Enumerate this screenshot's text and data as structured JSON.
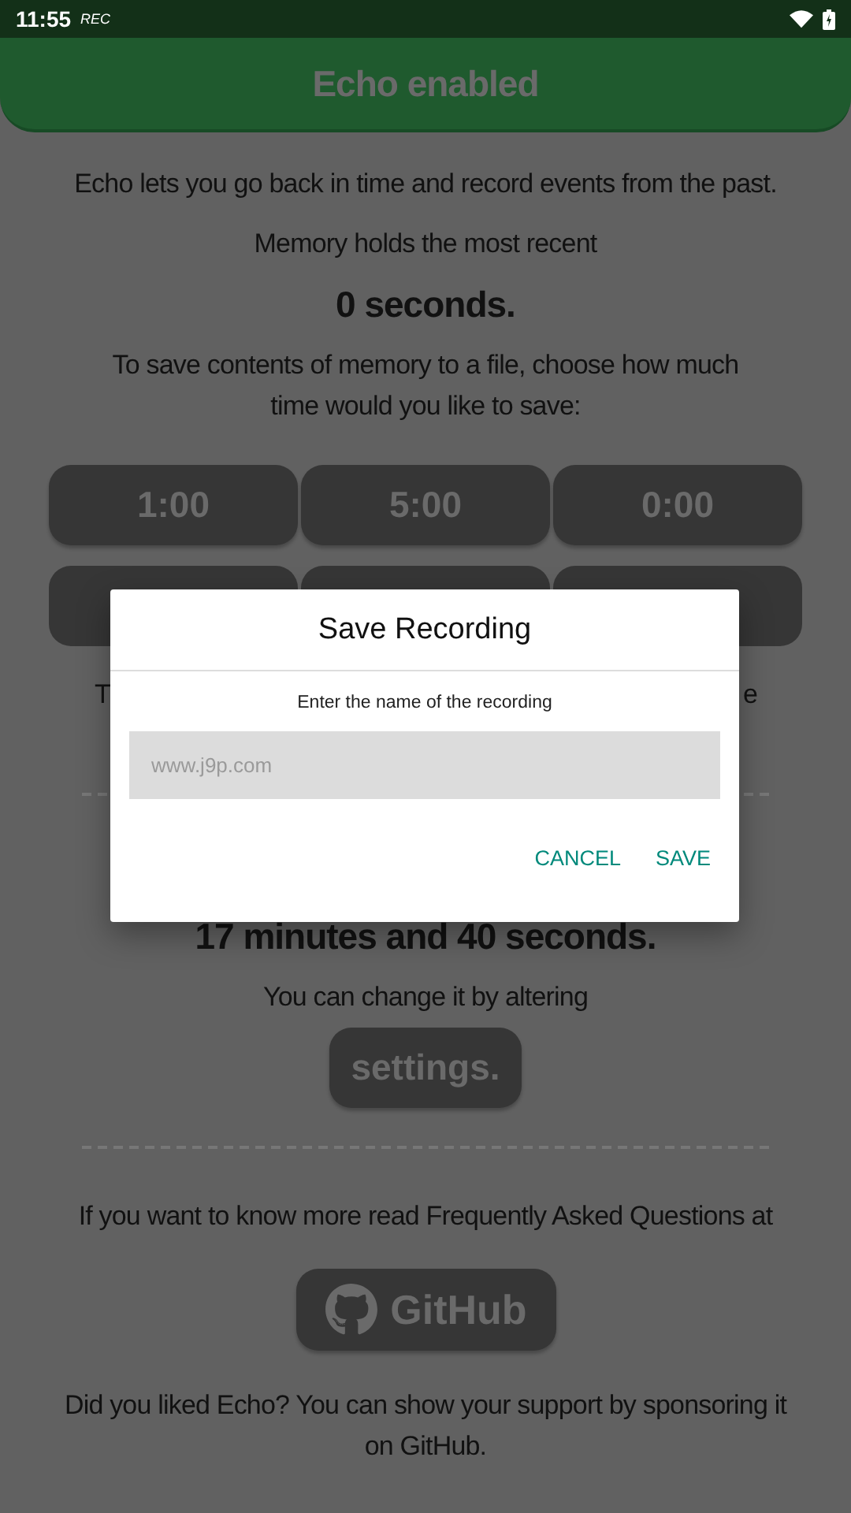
{
  "status_bar": {
    "time": "11:55",
    "recording_label": "REC"
  },
  "header": {
    "title": "Echo enabled"
  },
  "content": {
    "intro": "Echo lets you go back in time and record events from the past.",
    "memory_label": "Memory holds the most recent",
    "memory_value": "0 seconds.",
    "save_prompt": "To save contents of memory to a file, choose how much time would you like to save:",
    "duration_buttons": [
      {
        "kind": "labeled",
        "label": "1:00"
      },
      {
        "kind": "labeled",
        "label": "5:00"
      },
      {
        "kind": "labeled",
        "label": "0:00"
      },
      {
        "kind": "covered"
      },
      {
        "kind": "covered"
      },
      {
        "kind": "covered"
      }
    ],
    "covered_line": {
      "left": "T",
      "right": "e"
    },
    "limit_value": "17 minutes and 40 seconds.",
    "change_hint": "You can change it by altering",
    "settings_button": "settings.",
    "faq_text": "If you want to know more read Frequently Asked Questions at",
    "github_button": "GitHub",
    "sponsor_text": "Did you liked Echo? You can show your support by sponsoring it on GitHub."
  },
  "dialog": {
    "title": "Save Recording",
    "message": "Enter the name of the recording",
    "placeholder": "www.j9p.com",
    "actions": [
      {
        "label": "CANCEL"
      },
      {
        "label": "SAVE"
      }
    ]
  }
}
